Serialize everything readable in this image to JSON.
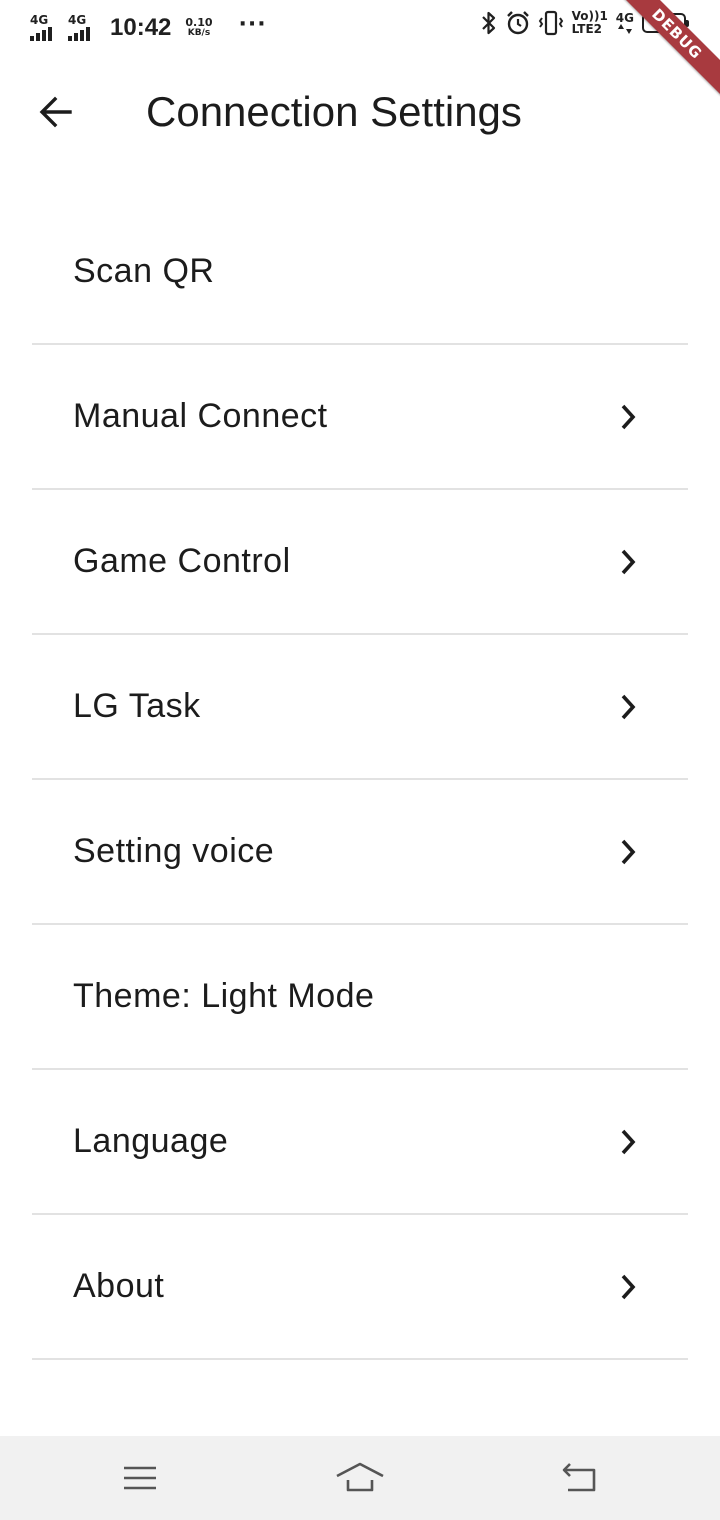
{
  "status_bar": {
    "net1": "4G",
    "net2": "4G",
    "time": "10:42",
    "speed_value": "0.10",
    "speed_unit": "KB/s",
    "more": "···",
    "volte_top": "Vo))",
    "volte_bottom": "LTE2",
    "volte_sim": "1",
    "net_right": "4G",
    "battery": "81"
  },
  "debug_banner": "DEBUG",
  "app_bar": {
    "back_icon": "arrow-left-icon",
    "title": "Connection Settings"
  },
  "settings": {
    "items": [
      {
        "label": "Scan QR",
        "has_chevron": false
      },
      {
        "label": "Manual Connect",
        "has_chevron": true
      },
      {
        "label": "Game Control",
        "has_chevron": true
      },
      {
        "label": "LG Task",
        "has_chevron": true
      },
      {
        "label": "Setting voice",
        "has_chevron": true
      },
      {
        "label": "Theme: Light Mode",
        "has_chevron": false
      },
      {
        "label": "Language",
        "has_chevron": true
      },
      {
        "label": "About",
        "has_chevron": true
      }
    ]
  },
  "nav_bar": {
    "menu_icon": "menu-icon",
    "home_icon": "home-icon",
    "back_icon": "back-icon"
  },
  "colors": {
    "background": "#ffffff",
    "divider": "#e2e2e2",
    "text": "#1c1c1c",
    "debug_ribbon": "#a83a3f",
    "nav_bar": "#f1f1f1"
  }
}
